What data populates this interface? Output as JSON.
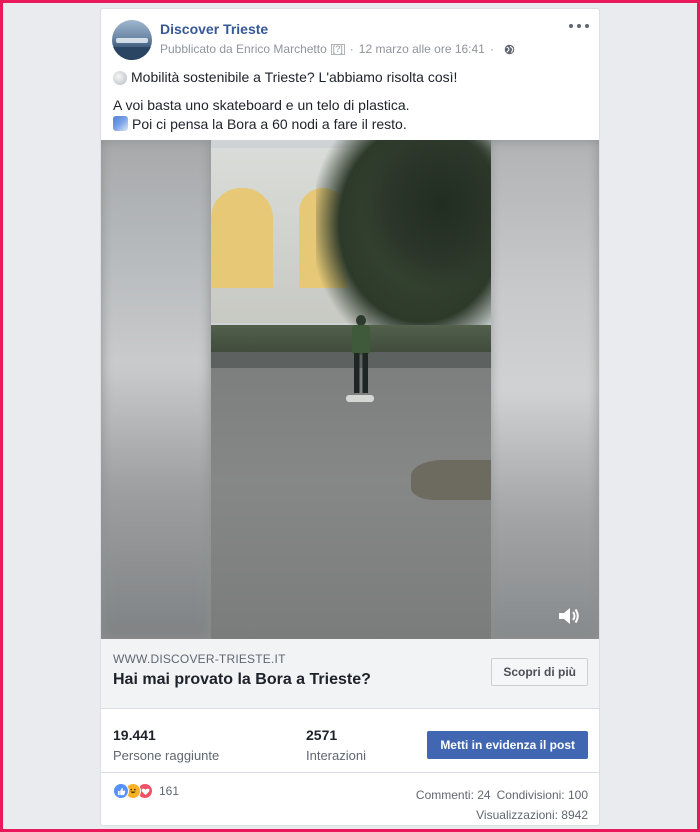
{
  "post": {
    "page_name": "Discover Trieste",
    "published_by": "Pubblicato da Enrico Marchetto",
    "help_mark": "[?]",
    "separator": "·",
    "timestamp": "12 marzo alle ore 16:41",
    "audience_icon": "globe-icon",
    "more_icon": "more-options-icon",
    "text_line1": "Mobilità sostenibile a Trieste? L'abbiamo risolta così!",
    "text_line2": "A voi basta uno skateboard e un telo di plastica.",
    "text_line3": "Poi ci pensa la Bora a 60 nodi a fare il resto."
  },
  "video": {
    "volume_icon": "speaker-icon"
  },
  "link": {
    "domain": "WWW.DISCOVER-TRIESTE.IT",
    "title": "Hai mai provato la Bora a Trieste?",
    "cta_label": "Scopri di più"
  },
  "stats": {
    "reach_value": "19.441",
    "reach_label": "Persone raggiunte",
    "interactions_value": "2571",
    "interactions_label": "Interazioni",
    "boost_label": "Metti in evidenza il post"
  },
  "engagement": {
    "reactions_count": "161",
    "comments": "Commenti: 24",
    "shares": "Condivisioni: 100",
    "views": "Visualizzazioni: 8942"
  },
  "colors": {
    "link_blue": "#365899",
    "boost_blue": "#4267b2",
    "frame_border": "#e8185a"
  }
}
